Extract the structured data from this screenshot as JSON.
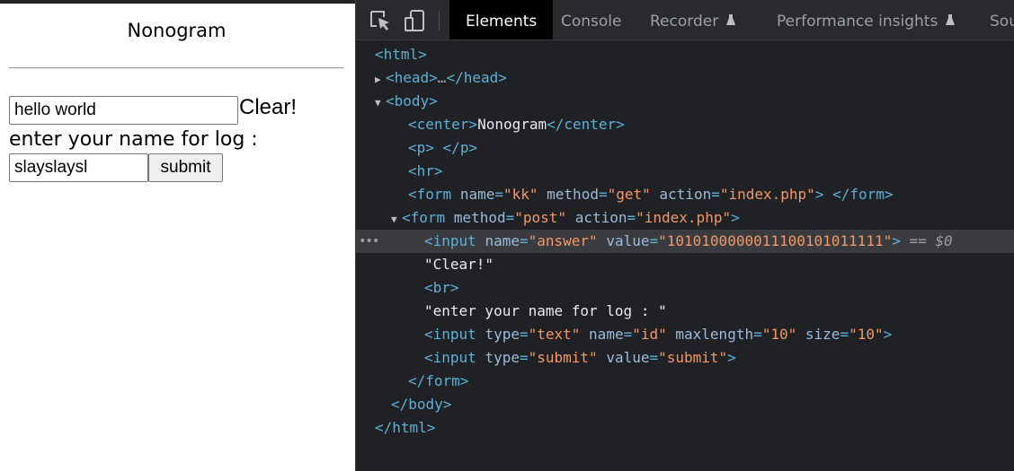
{
  "page": {
    "title": "Nonogram",
    "answer_value": "hello world",
    "clear_text": "Clear!",
    "enter_label": "enter your name for log :",
    "id_value": "slayslaysl",
    "submit_label": "submit"
  },
  "devtools": {
    "tabs": [
      {
        "label": "Elements",
        "active": true
      },
      {
        "label": "Console"
      },
      {
        "label": "Recorder"
      },
      {
        "label": "Performance insights"
      },
      {
        "label": "Sou"
      }
    ],
    "dom": {
      "html_open": "<html>",
      "head_tag": "<head>",
      "head_ellipsis": "…",
      "head_close": "</head>",
      "body_open": "<body>",
      "center_open": "<center>",
      "center_text": "Nonogram",
      "center_close": "</center>",
      "p_open": "<p>",
      "p_close": "</p>",
      "hr": "<hr>",
      "form1_tag": "<form",
      "form1_a1_name": "name",
      "form1_a1_val": "\"kk\"",
      "form1_a2_name": "method",
      "form1_a2_val": "\"get\"",
      "form1_a3_name": "action",
      "form1_a3_val": "\"index.php\"",
      "form1_end": ">",
      "form1_close": "</form>",
      "form2_tag": "<form",
      "form2_a1_name": "method",
      "form2_a1_val": "\"post\"",
      "form2_a2_name": "action",
      "form2_a2_val": "\"index.php\"",
      "form2_end": ">",
      "input1_tag": "<input",
      "input1_a1_name": "name",
      "input1_a1_val": "\"answer\"",
      "input1_a2_name": "value",
      "input1_a2_val": "\"1010100000011100101011111\"",
      "input1_end": ">",
      "input1_eq": "==",
      "input1_ref": "$0",
      "text_clear": "\"Clear!\"",
      "br": "<br>",
      "text_enter": "\"enter your name for log : \"",
      "input2_tag": "<input",
      "input2_a1_name": "type",
      "input2_a1_val": "\"text\"",
      "input2_a2_name": "name",
      "input2_a2_val": "\"id\"",
      "input2_a3_name": "maxlength",
      "input2_a3_val": "\"10\"",
      "input2_a4_name": "size",
      "input2_a4_val": "\"10\"",
      "input2_end": ">",
      "input3_tag": "<input",
      "input3_a1_name": "type",
      "input3_a1_val": "\"submit\"",
      "input3_a2_name": "value",
      "input3_a2_val": "\"submit\"",
      "input3_end": ">",
      "form2_close": "</form>",
      "body_close": "</body>",
      "html_close": "</html>"
    }
  },
  "colors": {
    "devtools_bg": "#202124",
    "tag": "#5db0d7",
    "attr_name": "#9bbbdc",
    "attr_value": "#f29766",
    "selected_row": "#393b3f"
  },
  "icons": [
    "inspect-element-icon",
    "device-toolbar-icon",
    "flask-icon",
    "expand-triangle-icon",
    "collapse-triangle-icon",
    "more-dots-icon"
  ]
}
